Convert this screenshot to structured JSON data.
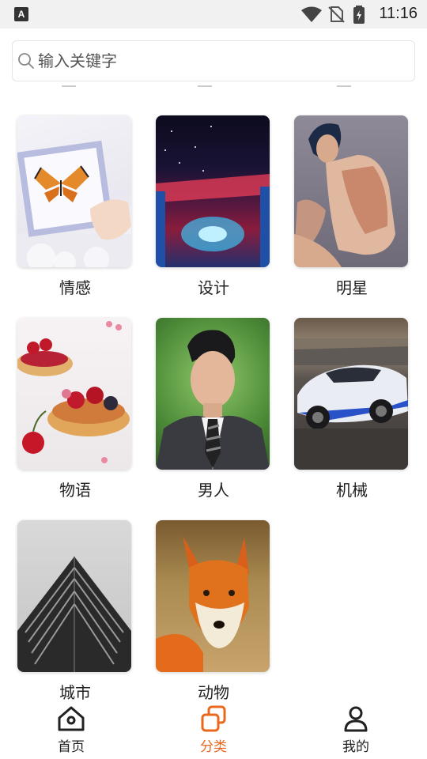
{
  "status_bar": {
    "left_icon": "A",
    "icons": [
      "wifi-icon",
      "no-sim-icon",
      "battery-charging-icon"
    ],
    "time": "11:16"
  },
  "search": {
    "placeholder": "输入关键字",
    "value": ""
  },
  "categories": [
    {
      "label": "情感",
      "image": "butterfly-frame-image"
    },
    {
      "label": "设计",
      "image": "crescent-moon-night-image"
    },
    {
      "label": "明星",
      "image": "celebrity-portrait-image"
    },
    {
      "label": "物语",
      "image": "cherry-tart-image"
    },
    {
      "label": "男人",
      "image": "man-in-suit-image"
    },
    {
      "label": "机械",
      "image": "sports-car-image"
    },
    {
      "label": "城市",
      "image": "skyscraper-image"
    },
    {
      "label": "动物",
      "image": "fox-image"
    }
  ],
  "bottom_nav": {
    "items": [
      {
        "label": "首页",
        "icon": "home-icon",
        "active": false
      },
      {
        "label": "分类",
        "icon": "category-icon",
        "active": true
      },
      {
        "label": "我的",
        "icon": "profile-icon",
        "active": false
      }
    ],
    "active_color": "#e8681e"
  }
}
